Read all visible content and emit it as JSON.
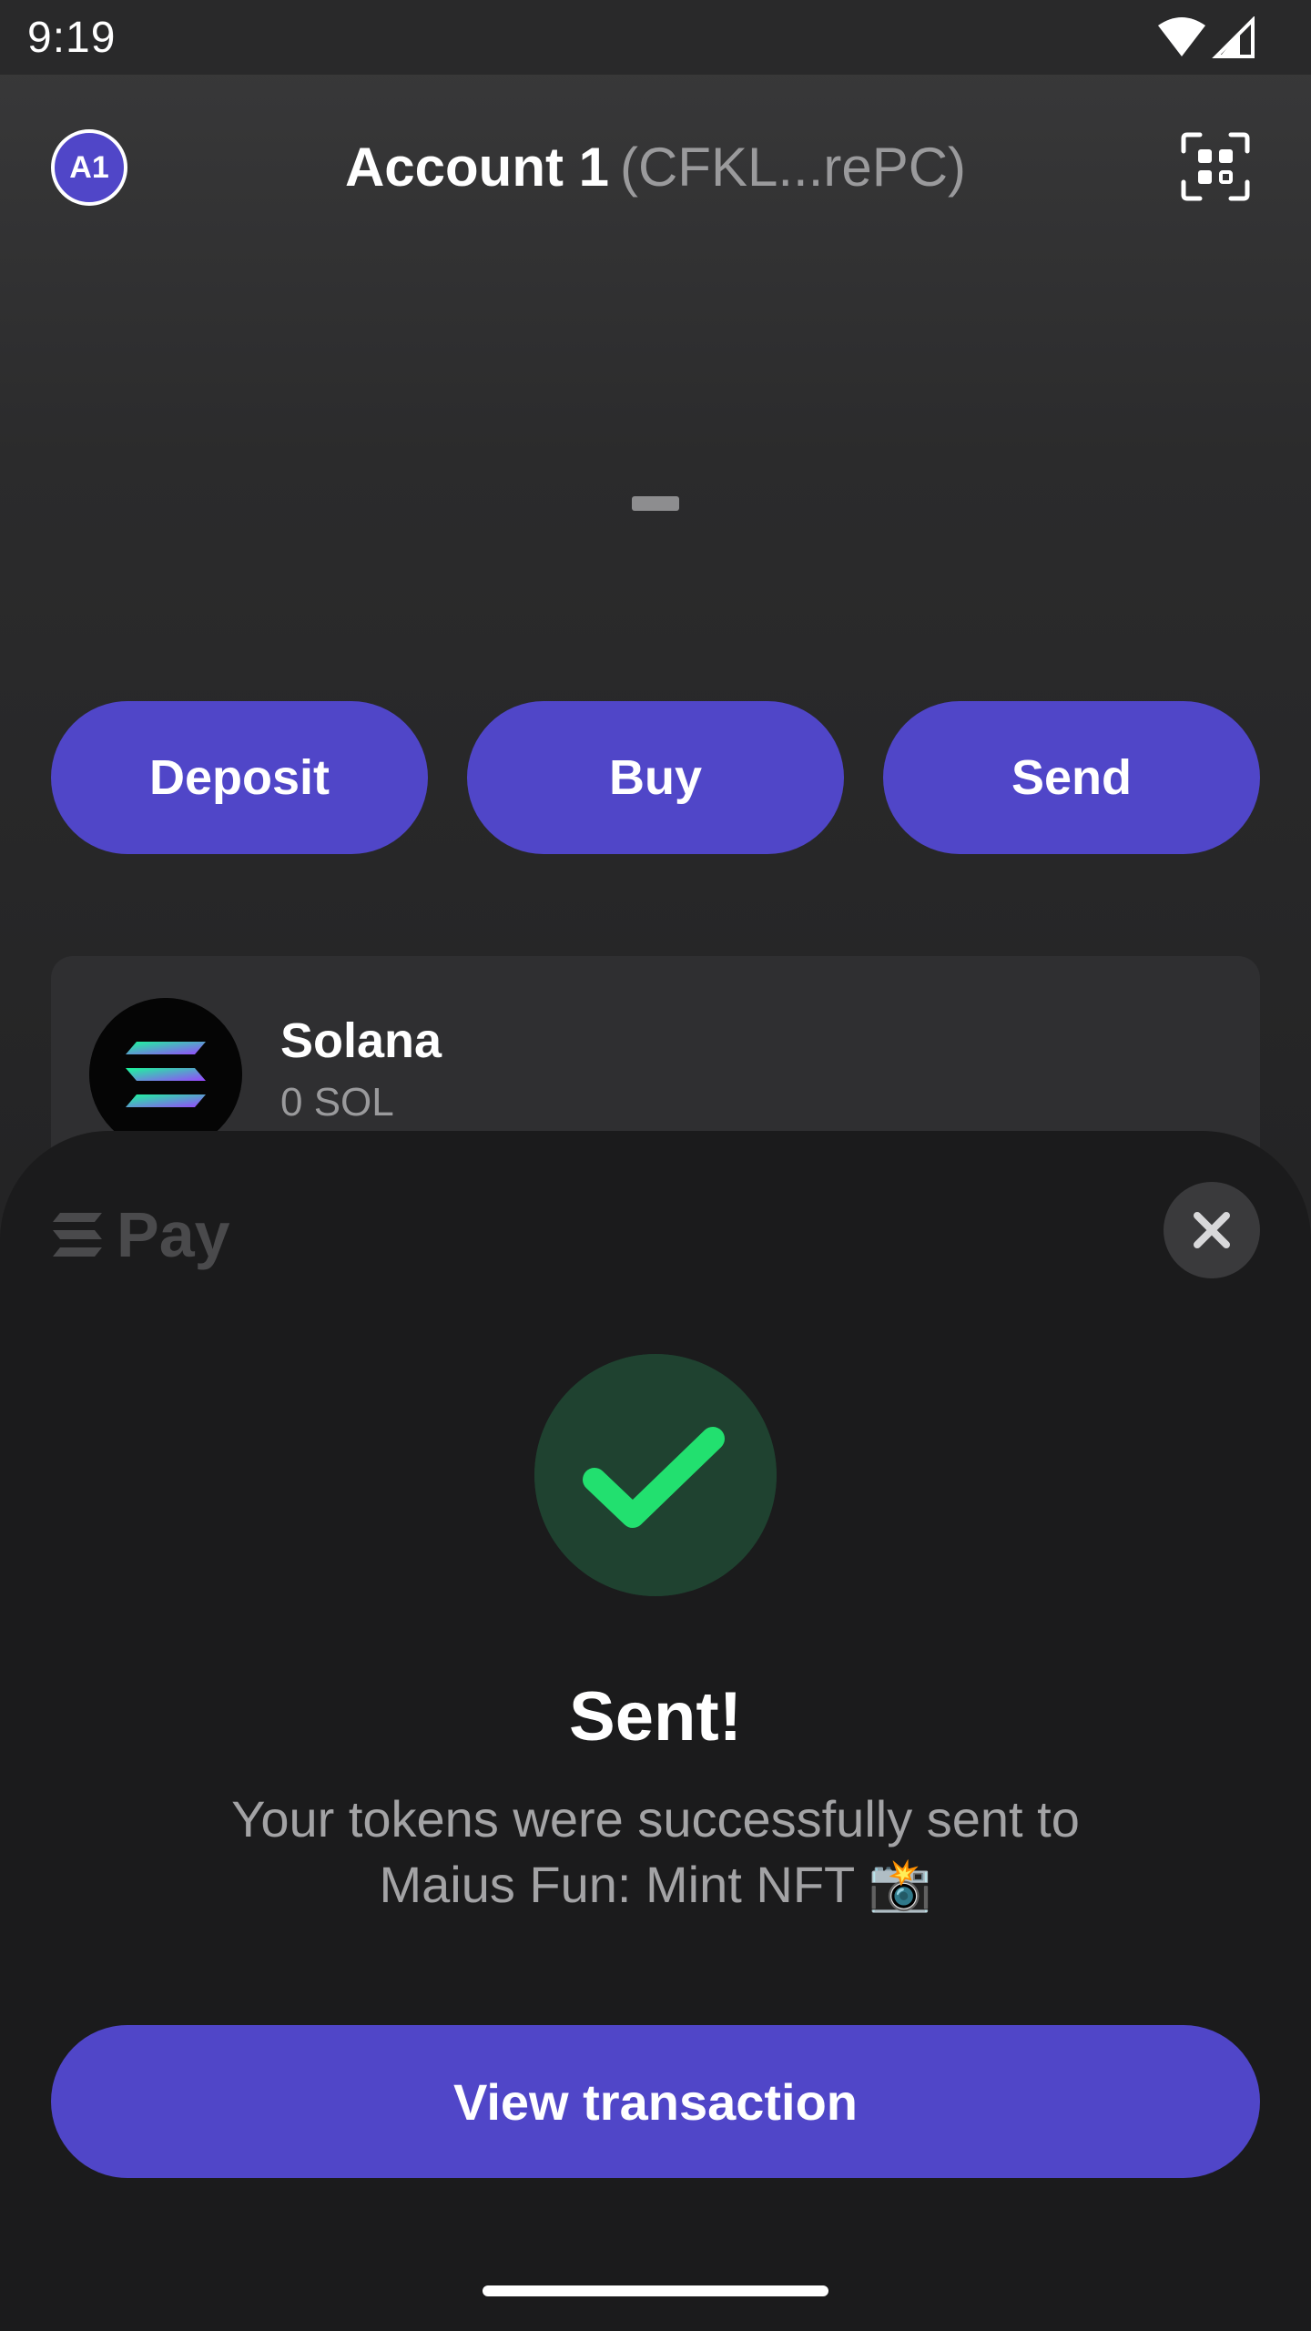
{
  "status_bar": {
    "time": "9:19",
    "icons": [
      "wifi-icon",
      "cell-signal-icon"
    ]
  },
  "header": {
    "avatar_label": "A1",
    "account_name": "Account 1",
    "account_address": "(CFKL...rePC)",
    "scan_icon": "qr-scan-icon"
  },
  "balance": {
    "placeholder": "–"
  },
  "actions": {
    "deposit_label": "Deposit",
    "buy_label": "Buy",
    "send_label": "Send"
  },
  "tokens": [
    {
      "name": "Solana",
      "balance": "0 SOL",
      "icon": "solana-logo"
    }
  ],
  "sheet": {
    "brand_label": "Pay",
    "brand_icon": "solana-pay-logo",
    "close_icon": "close-icon",
    "success_icon": "checkmark-icon",
    "title": "Sent!",
    "message_line1": "Your tokens were successfully sent to",
    "message_line2": "Maius Fun: Mint NFT 📸",
    "view_button_label": "View transaction"
  },
  "colors": {
    "accent": "#5046c8",
    "success_green": "#22e06f",
    "success_bg": "#1f4230",
    "sheet_bg": "#1b1b1c"
  }
}
